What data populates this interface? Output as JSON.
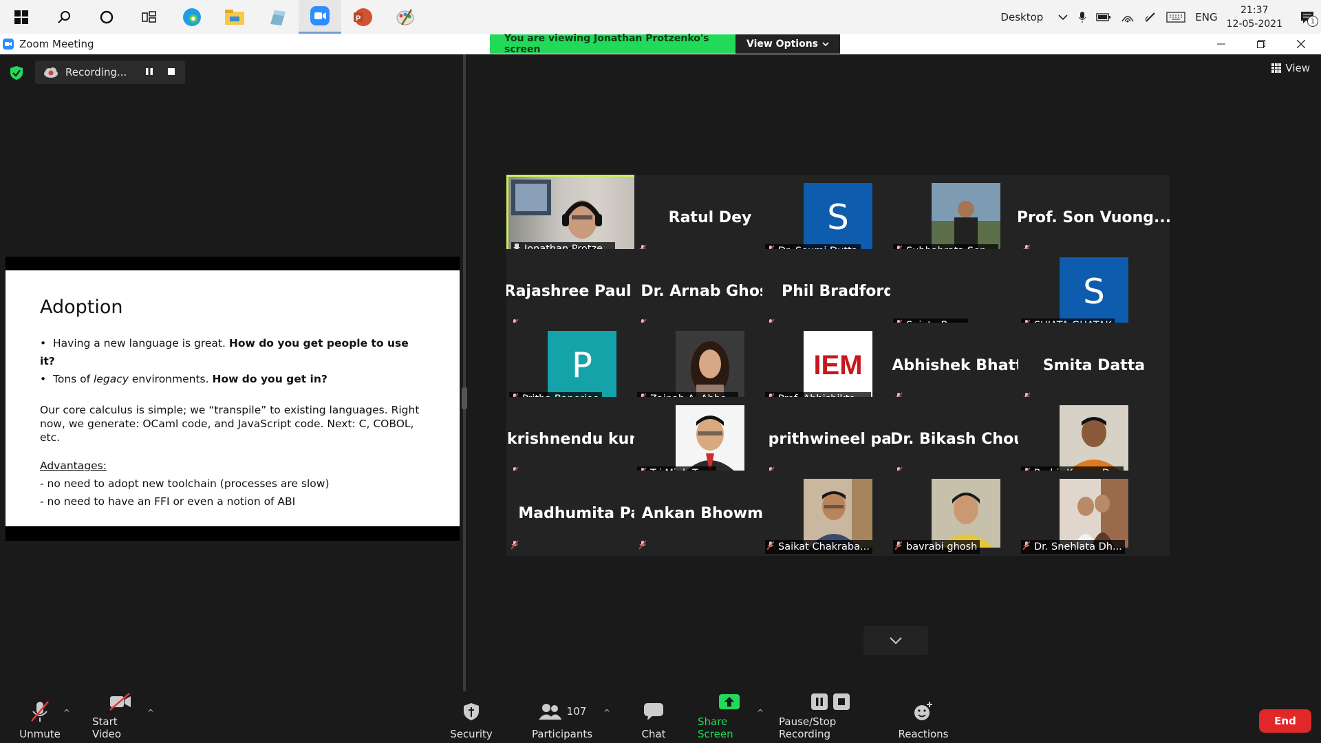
{
  "taskbar": {
    "desktop_label": "Desktop",
    "lang": "ENG",
    "time": "21:37",
    "date": "12-05-2021",
    "notifications": "1"
  },
  "window": {
    "title": "Zoom Meeting",
    "viewing_banner": "You are viewing Jonathan Protzenko's screen",
    "view_options": "View Options"
  },
  "recording": {
    "label": "Recording..."
  },
  "view_button": "View",
  "slide": {
    "title": "Adoption",
    "bullets": [
      {
        "plain": "Having a new language is great. ",
        "bold": "How do you get people to use it?"
      },
      {
        "plain_before": "Tons of ",
        "italic": "legacy",
        "plain_after": " environments. ",
        "bold": "How do you get in?"
      }
    ],
    "paragraph": "Our core calculus is simple; we “transpile” to existing languages. Right now, we generate: OCaml code, and JavaScript code. Next: C, COBOL, etc.",
    "advantages_heading": "Advantages:",
    "advantages": [
      "-  no need to adopt new toolchain (processes are slow)",
      "-  no need to have an FFI or even a notion of ABI"
    ]
  },
  "participants": [
    {
      "kind": "video",
      "label": "Jonathan Protze..."
    },
    {
      "kind": "name",
      "big": "Ratul Dey"
    },
    {
      "kind": "avatar",
      "letter": "S",
      "color": "#0e5cad",
      "label": "Dr. Soumi Dutta"
    },
    {
      "kind": "photo",
      "label": "Subhabrata Sen..."
    },
    {
      "kind": "name",
      "big": "Prof. Son Vuong..."
    },
    {
      "kind": "name",
      "big": "Rajashree  Paul  -..."
    },
    {
      "kind": "name",
      "big": "Dr. Arnab Ghosh"
    },
    {
      "kind": "name",
      "big": "Phil Bradford"
    },
    {
      "kind": "blank",
      "label": "Sujata Bose"
    },
    {
      "kind": "avatar",
      "letter": "S",
      "color": "#0e5cad",
      "label": "SUJATA GHATAK"
    },
    {
      "kind": "avatar",
      "letter": "P",
      "color": "#13a3a8",
      "label": "Pritha Banerjee"
    },
    {
      "kind": "photo",
      "label": "Zainab A. Abbo..."
    },
    {
      "kind": "logo",
      "logo": "IEM",
      "label": "Prof. Abhishikta ..."
    },
    {
      "kind": "name",
      "big": "Abhishek  Bhatt..."
    },
    {
      "kind": "name",
      "big": "Smita Datta"
    },
    {
      "kind": "name",
      "big": "krishnendu  kun..."
    },
    {
      "kind": "photo",
      "label": "Tri Minh Tran"
    },
    {
      "kind": "name",
      "big": "prithwineel paul"
    },
    {
      "kind": "name",
      "big": "Dr.  Bikash  Chou..."
    },
    {
      "kind": "photo",
      "label": "Prabir Kumar Das"
    },
    {
      "kind": "name",
      "big": "Madhumita Pal"
    },
    {
      "kind": "name",
      "big": "Ankan Bhowmik"
    },
    {
      "kind": "photo",
      "label": "Saikat Chakraba..."
    },
    {
      "kind": "photo",
      "label": "bavrabi ghosh"
    },
    {
      "kind": "photo",
      "label": "Dr. Snehlata Dh..."
    }
  ],
  "toolbar": {
    "unmute": "Unmute",
    "start_video": "Start Video",
    "security": "Security",
    "participants": "Participants",
    "participant_count": "107",
    "chat": "Chat",
    "share_screen": "Share Screen",
    "pause_stop": "Pause/Stop Recording",
    "reactions": "Reactions",
    "end": "End"
  },
  "colors": {
    "accent_green": "#23d959",
    "speaker_border": "#c8ef59",
    "end_red": "#e02828",
    "mute_red": "#e03a3a"
  }
}
